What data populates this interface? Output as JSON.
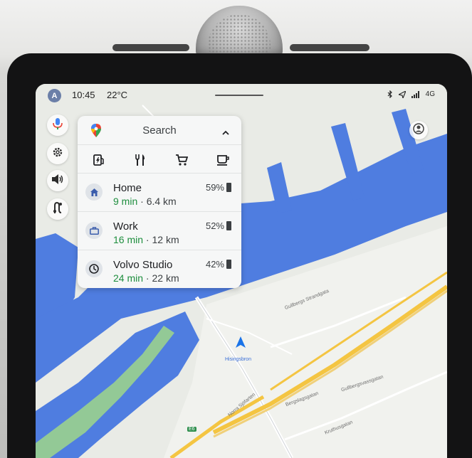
{
  "status_bar": {
    "avatar_letter": "A",
    "time": "10:45",
    "temperature": "22°C",
    "network": "4G"
  },
  "search_panel": {
    "search_label": "Search",
    "categories": [
      "ev-charger-icon",
      "restaurant-icon",
      "grocery-icon",
      "coffee-icon"
    ],
    "destinations": [
      {
        "name": "Home",
        "eta": "9 min",
        "distance": "6.4 km",
        "battery": "59%",
        "icon": "home-icon"
      },
      {
        "name": "Work",
        "eta": "16 min",
        "distance": "12 km",
        "battery": "52%",
        "icon": "briefcase-icon"
      },
      {
        "name": "Volvo Studio",
        "eta": "24 min",
        "distance": "22 km",
        "battery": "42%",
        "icon": "clock-icon"
      }
    ],
    "separator": "·"
  },
  "map": {
    "labels": {
      "street1": "Gullbergs Strandgata",
      "street2": "Gullbergsvassgatan",
      "street3": "Norra Sjöfarten",
      "street4": "Bergslagsgatan",
      "street5": "Kruthusgatan",
      "bridge": "Hisingsbron",
      "road_shield": "E6"
    },
    "colors": {
      "water": "#4f7de0",
      "land": "#e9ebe6",
      "park": "#93c996",
      "highway": "#f4c542",
      "accent_green": "#1e8e3e"
    }
  }
}
